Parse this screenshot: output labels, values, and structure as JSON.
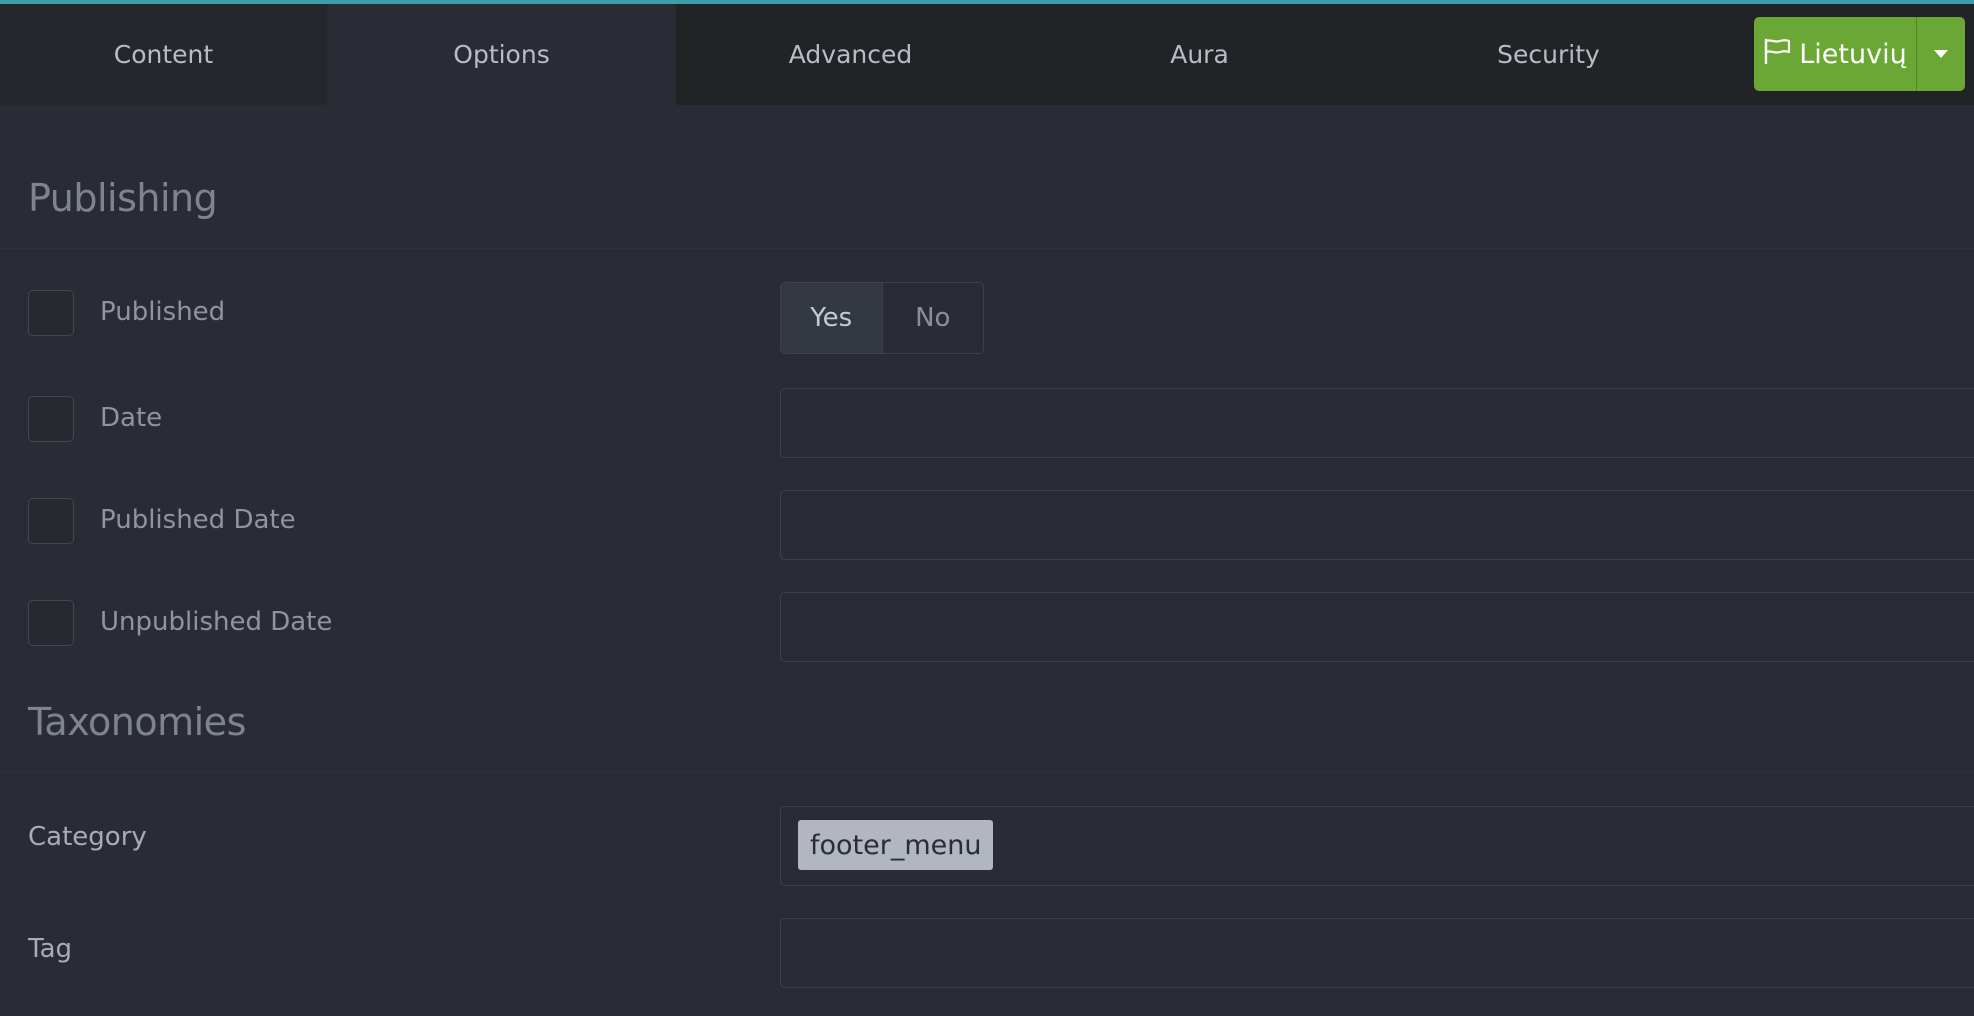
{
  "tabs": [
    {
      "label": "Content"
    },
    {
      "label": "Options"
    },
    {
      "label": "Advanced"
    },
    {
      "label": "Aura"
    },
    {
      "label": "Security"
    }
  ],
  "active_tab": "Options",
  "language": {
    "label": "Lietuvių",
    "icon": "flag-icon",
    "dropdown_icon": "caret-down-icon",
    "color": "#6aa734"
  },
  "publishing": {
    "title": "Publishing",
    "published": {
      "label": "Published",
      "yes_label": "Yes",
      "no_label": "No",
      "selected": "Yes"
    },
    "date": {
      "label": "Date",
      "value": ""
    },
    "published_date": {
      "label": "Published Date",
      "value": ""
    },
    "unpublished_date": {
      "label": "Unpublished Date",
      "value": ""
    }
  },
  "taxonomies": {
    "title": "Taxonomies",
    "category": {
      "label": "Category",
      "chips": [
        "footer_menu"
      ]
    },
    "tag": {
      "label": "Tag",
      "value": ""
    }
  },
  "colors": {
    "accent_top": "#3f9cab",
    "background": "#292c35",
    "tabbar": "#222327"
  }
}
